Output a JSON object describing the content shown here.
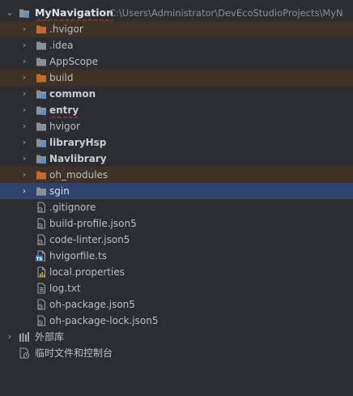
{
  "project": {
    "root_name": "MyNavigation",
    "root_path": "C:\\Users\\Administrator\\DevEcoStudioProjects\\MyN"
  },
  "folders": [
    {
      "label": ".hvigor"
    },
    {
      "label": ".idea"
    },
    {
      "label": "AppScope"
    },
    {
      "label": "build"
    },
    {
      "label": "common"
    },
    {
      "label": "entry"
    },
    {
      "label": "hvigor"
    },
    {
      "label": "libraryHsp"
    },
    {
      "label": "Navlibrary"
    },
    {
      "label": "oh_modules"
    },
    {
      "label": "sgin"
    }
  ],
  "files": [
    {
      "label": ".gitignore"
    },
    {
      "label": "build-profile.json5"
    },
    {
      "label": "code-linter.json5"
    },
    {
      "label": "hvigorfile.ts"
    },
    {
      "label": "local.properties"
    },
    {
      "label": "log.txt"
    },
    {
      "label": "oh-package.json5"
    },
    {
      "label": "oh-package-lock.json5"
    }
  ],
  "external_libraries": {
    "label": "外部库"
  },
  "scratches": {
    "label": "临时文件和控制台"
  },
  "colors": {
    "background": "#2b2d30",
    "selection": "#2e436e",
    "excluded_row": "#3d3223",
    "excluded_folder": "#c26a2b",
    "folder": "#8c9095",
    "module_badge": "#4e8fd6",
    "ts_badge": "#3a7bd5",
    "error_underline": "#b34040"
  }
}
